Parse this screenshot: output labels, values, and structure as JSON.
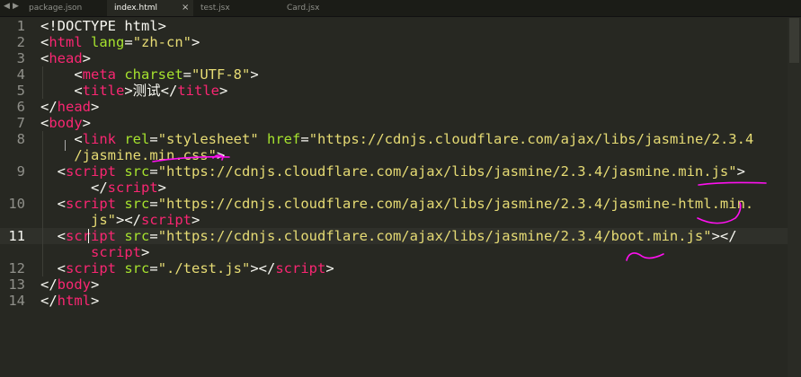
{
  "tabs": [
    {
      "label": "package.json",
      "active": false
    },
    {
      "label": "index.html",
      "active": true,
      "close_glyph": "×"
    },
    {
      "label": "test.jsx",
      "active": false
    },
    {
      "label": "Card.jsx",
      "active": false
    }
  ],
  "editor": {
    "active_line": 11,
    "line_numbers": [
      "1",
      "2",
      "3",
      "4",
      "5",
      "6",
      "7",
      "8",
      "",
      "9",
      "",
      "10",
      "",
      "11",
      "",
      "12",
      "13",
      "14"
    ],
    "lines": [
      [
        {
          "c": "p",
          "v": "<!DOCTYPE html>"
        }
      ],
      [
        {
          "c": "p",
          "v": "<"
        },
        {
          "c": "t",
          "v": "html"
        },
        {
          "c": "p",
          "v": " "
        },
        {
          "c": "a",
          "v": "lang"
        },
        {
          "c": "p",
          "v": "="
        },
        {
          "c": "s",
          "v": "\"zh-cn\""
        },
        {
          "c": "p",
          "v": ">"
        }
      ],
      [
        {
          "c": "p",
          "v": "<"
        },
        {
          "c": "t",
          "v": "head"
        },
        {
          "c": "p",
          "v": ">"
        }
      ],
      [
        {
          "c": "p",
          "v": "    <"
        },
        {
          "c": "t",
          "v": "meta"
        },
        {
          "c": "p",
          "v": " "
        },
        {
          "c": "a",
          "v": "charset"
        },
        {
          "c": "p",
          "v": "="
        },
        {
          "c": "s",
          "v": "\"UTF-8\""
        },
        {
          "c": "p",
          "v": ">"
        }
      ],
      [
        {
          "c": "p",
          "v": "    <"
        },
        {
          "c": "t",
          "v": "title"
        },
        {
          "c": "p",
          "v": ">测试</"
        },
        {
          "c": "t",
          "v": "title"
        },
        {
          "c": "p",
          "v": ">"
        }
      ],
      [
        {
          "c": "p",
          "v": "</"
        },
        {
          "c": "t",
          "v": "head"
        },
        {
          "c": "p",
          "v": ">"
        }
      ],
      [
        {
          "c": "p",
          "v": "<"
        },
        {
          "c": "t",
          "v": "body"
        },
        {
          "c": "p",
          "v": ">"
        }
      ],
      [
        {
          "c": "p",
          "v": "    <"
        },
        {
          "c": "t",
          "v": "link"
        },
        {
          "c": "p",
          "v": " "
        },
        {
          "c": "a",
          "v": "rel"
        },
        {
          "c": "p",
          "v": "="
        },
        {
          "c": "s",
          "v": "\"stylesheet\""
        },
        {
          "c": "p",
          "v": " "
        },
        {
          "c": "a",
          "v": "href"
        },
        {
          "c": "p",
          "v": "="
        },
        {
          "c": "s",
          "v": "\"https://cdnjs.cloudflare.com/ajax/libs/jasmine/2.3.4"
        }
      ],
      [
        {
          "c": "s",
          "v": "    /jasmine.min.css\""
        },
        {
          "c": "p",
          "v": ">"
        }
      ],
      [
        {
          "c": "p",
          "v": "  <"
        },
        {
          "c": "t",
          "v": "script"
        },
        {
          "c": "p",
          "v": " "
        },
        {
          "c": "a",
          "v": "src"
        },
        {
          "c": "p",
          "v": "="
        },
        {
          "c": "s",
          "v": "\"https://cdnjs.cloudflare.com/ajax/libs/jasmine/2.3.4/jasmine.min.js\""
        },
        {
          "c": "p",
          "v": ">"
        }
      ],
      [
        {
          "c": "p",
          "v": "      </"
        },
        {
          "c": "t",
          "v": "script"
        },
        {
          "c": "p",
          "v": ">"
        }
      ],
      [
        {
          "c": "p",
          "v": "  <"
        },
        {
          "c": "t",
          "v": "script"
        },
        {
          "c": "p",
          "v": " "
        },
        {
          "c": "a",
          "v": "src"
        },
        {
          "c": "p",
          "v": "="
        },
        {
          "c": "s",
          "v": "\"https://cdnjs.cloudflare.com/ajax/libs/jasmine/2.3.4/jasmine-html.min."
        }
      ],
      [
        {
          "c": "s",
          "v": "      js\""
        },
        {
          "c": "p",
          "v": "></"
        },
        {
          "c": "t",
          "v": "script"
        },
        {
          "c": "p",
          "v": ">"
        }
      ],
      [
        {
          "c": "p",
          "v": "  <"
        },
        {
          "c": "t",
          "v": "script"
        },
        {
          "c": "p",
          "v": " "
        },
        {
          "c": "a",
          "v": "src"
        },
        {
          "c": "p",
          "v": "="
        },
        {
          "c": "s",
          "v": "\"https://cdnjs.cloudflare.com/ajax/libs/jasmine/2.3.4/boot.min.js\""
        },
        {
          "c": "p",
          "v": "></"
        }
      ],
      [
        {
          "c": "t",
          "v": "      script"
        },
        {
          "c": "p",
          "v": ">"
        }
      ],
      [
        {
          "c": "p",
          "v": "  <"
        },
        {
          "c": "t",
          "v": "script"
        },
        {
          "c": "p",
          "v": " "
        },
        {
          "c": "a",
          "v": "src"
        },
        {
          "c": "p",
          "v": "="
        },
        {
          "c": "s",
          "v": "\"./test.js\""
        },
        {
          "c": "p",
          "v": "></"
        },
        {
          "c": "t",
          "v": "script"
        },
        {
          "c": "p",
          "v": ">"
        }
      ],
      [
        {
          "c": "p",
          "v": "</"
        },
        {
          "c": "t",
          "v": "body"
        },
        {
          "c": "p",
          "v": ">"
        }
      ],
      [
        {
          "c": "p",
          "v": "</"
        },
        {
          "c": "t",
          "v": "html"
        },
        {
          "c": "p",
          "v": ">"
        }
      ]
    ]
  },
  "colors": {
    "background": "#272822",
    "tag": "#f92672",
    "attribute": "#a6e22e",
    "string": "#e6db74",
    "plain": "#f8f8f2",
    "annotation": "#ff10f0"
  }
}
